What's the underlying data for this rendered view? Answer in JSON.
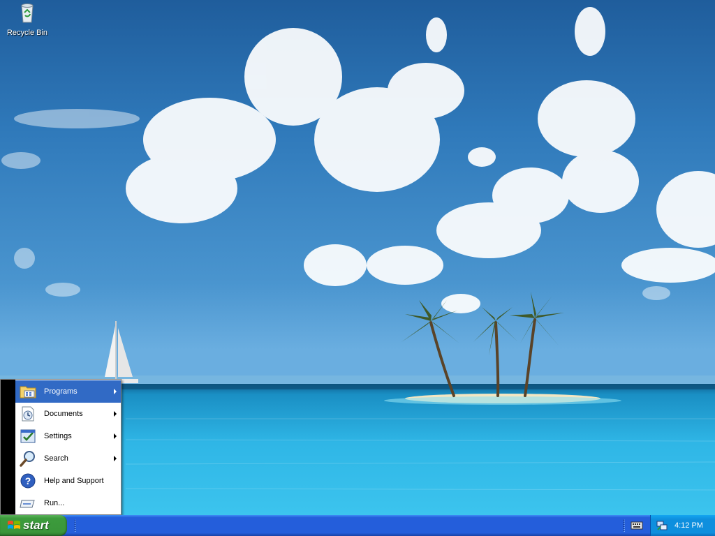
{
  "desktop": {
    "icons": [
      {
        "label": "Recycle Bin",
        "icon": "recycle-bin-icon"
      }
    ]
  },
  "start_menu": {
    "items": [
      {
        "label": "Programs",
        "icon": "programs-folder-icon",
        "submenu": true,
        "highlighted": true
      },
      {
        "label": "Documents",
        "icon": "documents-icon",
        "submenu": true
      },
      {
        "label": "Settings",
        "icon": "settings-icon",
        "submenu": true
      },
      {
        "label": "Search",
        "icon": "search-magnifier-icon",
        "submenu": true
      },
      {
        "label": "Help and Support",
        "icon": "help-icon",
        "submenu": false
      },
      {
        "label": "Run...",
        "icon": "run-icon",
        "submenu": false
      }
    ]
  },
  "taskbar": {
    "start_label": "start",
    "clock": "4:12 PM"
  },
  "colors": {
    "taskbar_blue": "#245edb",
    "start_green": "#3a963a",
    "menu_highlight": "#316ac5",
    "tray_blue": "#0e8fde"
  }
}
